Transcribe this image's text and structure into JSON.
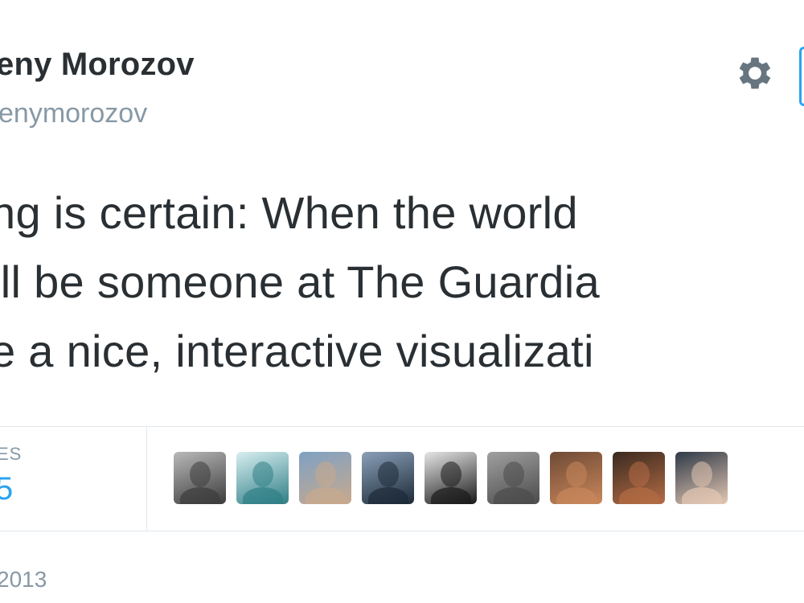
{
  "author": {
    "name": "eny Morozov",
    "handle": "enymorozov"
  },
  "tweet": {
    "lines": [
      "ng is certain: When the world",
      "ill be someone at The Guardia",
      "e a nice, interactive visualizati"
    ]
  },
  "stats": {
    "label": "ES",
    "value": "5"
  },
  "favorited_by": [
    {
      "name": "avatar-1",
      "colors": [
        "#3c3c3c",
        "#b9b9b9"
      ]
    },
    {
      "name": "avatar-2",
      "colors": [
        "#2f7f86",
        "#d8eef0"
      ]
    },
    {
      "name": "avatar-3",
      "colors": [
        "#c8a98d",
        "#7ea1c4"
      ]
    },
    {
      "name": "avatar-4",
      "colors": [
        "#1d2a38",
        "#8aa0b8"
      ]
    },
    {
      "name": "avatar-5",
      "colors": [
        "#1a1a1a",
        "#e6e6e6"
      ]
    },
    {
      "name": "avatar-6",
      "colors": [
        "#4b4b4b",
        "#a0a0a0"
      ]
    },
    {
      "name": "avatar-7",
      "colors": [
        "#c9875b",
        "#6e4a35"
      ]
    },
    {
      "name": "avatar-8",
      "colors": [
        "#b46c45",
        "#3a2a20"
      ]
    },
    {
      "name": "avatar-9",
      "colors": [
        "#e4c7b3",
        "#2f3a48"
      ]
    }
  ],
  "timestamp": "2013",
  "colors": {
    "text": "#292f33",
    "muted": "#8899a6",
    "accent": "#2aa3ef",
    "divider": "#e1e8ed"
  },
  "icons": {
    "settings": "gear-icon"
  }
}
